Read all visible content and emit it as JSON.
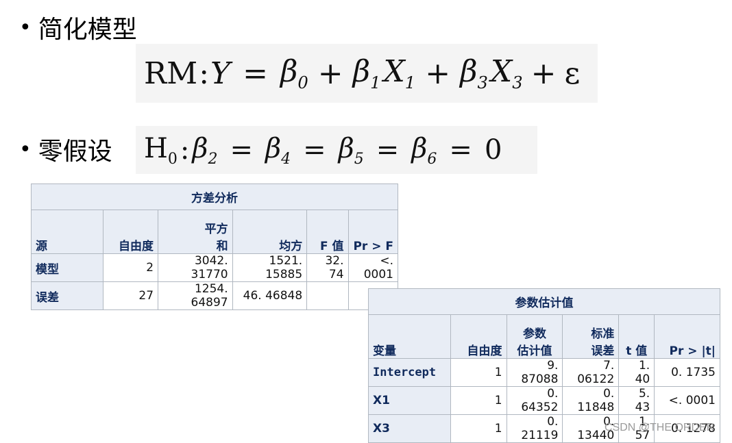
{
  "bullets": {
    "simplified_model": "简化模型",
    "null_hypothesis": "零假设"
  },
  "formulas": {
    "reduced_model": {
      "prefix": "RM",
      "colon": ":",
      "lhs": "Y",
      "eq": "=",
      "b0": "β",
      "b0_sub": "0",
      "plus1": "+",
      "b1": "β",
      "b1_sub": "1",
      "x1": "X",
      "x1_sub": "1",
      "plus2": "+",
      "b3": "β",
      "b3_sub": "3",
      "x3": "X",
      "x3_sub": "3",
      "plus3": "+",
      "eps": "ε"
    },
    "null": {
      "h": "H",
      "h_sub": "0",
      "colon": ":",
      "b2": "β",
      "b2_sub": "2",
      "eq1": "=",
      "b4": "β",
      "b4_sub": "4",
      "eq2": "=",
      "b5": "β",
      "b5_sub": "5",
      "eq3": "=",
      "b6": "β",
      "b6_sub": "6",
      "eq4": "=",
      "zero": "0"
    }
  },
  "anova_table": {
    "caption": "方差分析",
    "headers": {
      "source": "源",
      "df": "自由度",
      "ss_line1": "平方",
      "ss_line2": "和",
      "ms": "均方",
      "f": "F 值",
      "p": "Pr > F"
    },
    "rows": [
      {
        "source": "模型",
        "df": "2",
        "ss": "3042. 31770",
        "ms": "1521. 15885",
        "f": "32. 74",
        "p": "<. 0001"
      },
      {
        "source": "误差",
        "df": "27",
        "ss": "1254. 64897",
        "ms": "46. 46848",
        "f": "",
        "p": ""
      }
    ]
  },
  "param_table": {
    "caption": "参数估计值",
    "headers": {
      "var": "变量",
      "df": "自由度",
      "est_line1": "参数",
      "est_line2": "估计值",
      "se_line1": "标准",
      "se_line2": "误差",
      "t": "t 值",
      "p": "Pr > |t|"
    },
    "rows": [
      {
        "var": "Intercept",
        "df": "1",
        "est": "9. 87088",
        "se": "7. 06122",
        "t": "1. 40",
        "p": "0. 1735"
      },
      {
        "var": "X1",
        "df": "1",
        "est": "0. 64352",
        "se": "0. 11848",
        "t": "5. 43",
        "p": "<. 0001"
      },
      {
        "var": "X3",
        "df": "1",
        "est": "0. 21119",
        "se": "0. 13440",
        "t": "1. 57",
        "p": "0. 1278"
      }
    ]
  },
  "watermark": "CSDN @THE ORDER"
}
